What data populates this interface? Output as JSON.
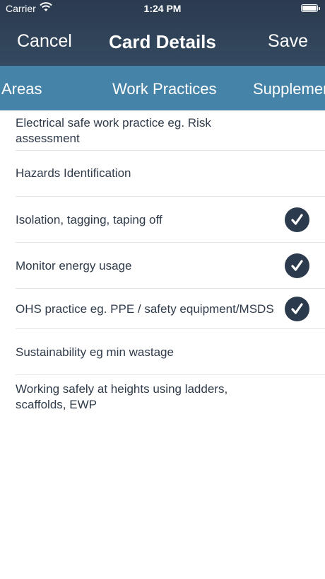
{
  "status_bar": {
    "carrier": "Carrier",
    "time": "1:24 PM"
  },
  "nav": {
    "cancel_label": "Cancel",
    "title": "Card Details",
    "save_label": "Save"
  },
  "tabs": [
    {
      "label": "Areas"
    },
    {
      "label": "Work Practices"
    },
    {
      "label": "Supplemen"
    }
  ],
  "items": [
    {
      "label": "Electrical safe work practice eg. Risk assessment",
      "checked": false
    },
    {
      "label": "Hazards Identification",
      "checked": false
    },
    {
      "label": "Isolation, tagging, taping off",
      "checked": true
    },
    {
      "label": "Monitor energy usage",
      "checked": true
    },
    {
      "label": "OHS practice eg. PPE / safety equipment/MSDS",
      "checked": true
    },
    {
      "label": "Sustainability eg min wastage",
      "checked": false
    },
    {
      "label": "Working safely at heights using ladders, scaffolds, EWP",
      "checked": false
    }
  ],
  "colors": {
    "header": "#2b3a4f",
    "tabbar": "#4584a8",
    "checkmark_bg": "#2c3a4d"
  }
}
